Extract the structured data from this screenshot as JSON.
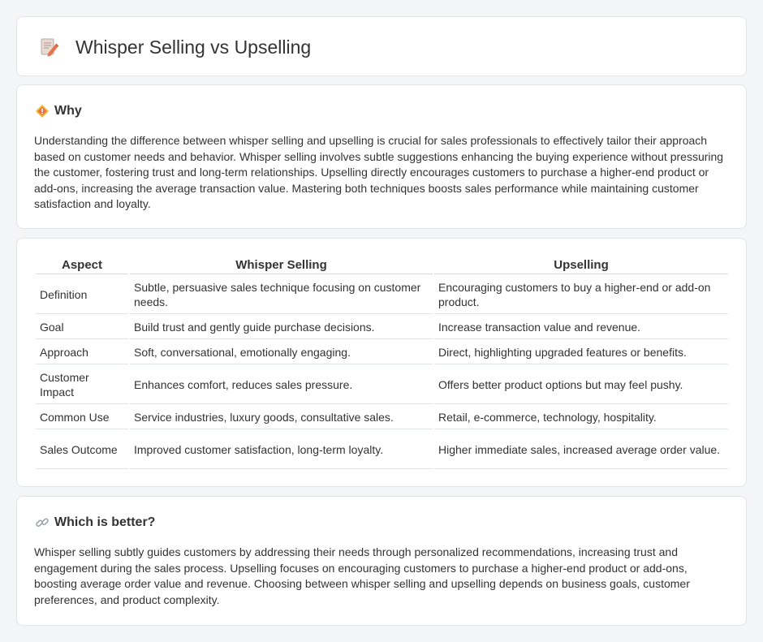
{
  "header": {
    "title": "Whisper Selling vs Upselling",
    "icon": "document-pencil-icon"
  },
  "why": {
    "title": "Why",
    "icon": "diamond-warning-icon",
    "body": "Understanding the difference between whisper selling and upselling is crucial for sales professionals to effectively tailor their approach based on customer needs and behavior. Whisper selling involves subtle suggestions enhancing the buying experience without pressuring the customer, fostering trust and long-term relationships. Upselling directly encourages customers to purchase a higher-end product or add-ons, increasing the average transaction value. Mastering both techniques boosts sales performance while maintaining customer satisfaction and loyalty."
  },
  "comparison": {
    "headers": [
      "Aspect",
      "Whisper Selling",
      "Upselling"
    ],
    "rows": [
      {
        "aspect": "Definition",
        "whisper": "Subtle, persuasive sales technique focusing on customer needs.",
        "upselling": "Encouraging customers to buy a higher-end or add-on product."
      },
      {
        "aspect": "Goal",
        "whisper": "Build trust and gently guide purchase decisions.",
        "upselling": "Increase transaction value and revenue."
      },
      {
        "aspect": "Approach",
        "whisper": "Soft, conversational, emotionally engaging.",
        "upselling": "Direct, highlighting upgraded features or benefits."
      },
      {
        "aspect": "Customer Impact",
        "whisper": "Enhances comfort, reduces sales pressure.",
        "upselling": "Offers better product options but may feel pushy."
      },
      {
        "aspect": "Common Use",
        "whisper": "Service industries, luxury goods, consultative sales.",
        "upselling": "Retail, e-commerce, technology, hospitality."
      },
      {
        "aspect": "Sales Outcome",
        "whisper": "Improved customer satisfaction, long-term loyalty.",
        "upselling": "Higher immediate sales, increased average order value."
      }
    ]
  },
  "better": {
    "title": "Which is better?",
    "icon": "link-icon",
    "body": "Whisper selling subtly guides customers by addressing their needs through personalized recommendations, increasing trust and engagement during the sales process. Upselling focuses on encouraging customers to purchase a higher-end product or add-ons, boosting average order value and revenue. Choosing between whisper selling and upselling depends on business goals, customer preferences, and product complexity."
  },
  "colors": {
    "background": "#f4f5f7",
    "card": "#ffffff",
    "border": "#e1e4e8",
    "text": "#333333",
    "icon_accent": "#e8734a",
    "warning_yellow": "#f5b731"
  }
}
